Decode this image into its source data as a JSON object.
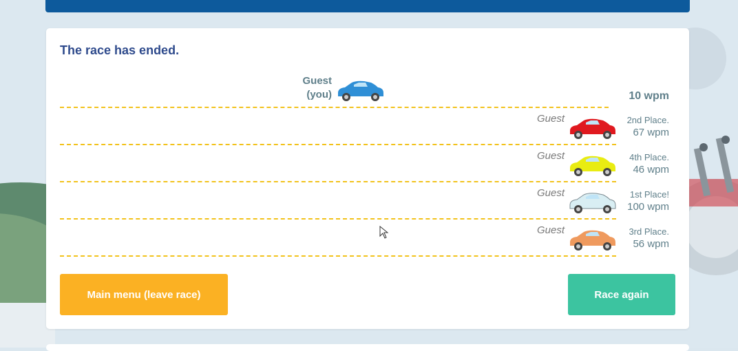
{
  "race": {
    "status_title": "The race has ended.",
    "you": {
      "name_line1": "Guest",
      "name_line2": "(you)",
      "wpm": "10 wpm",
      "car_color": "#2f8fd6"
    },
    "opponents": [
      {
        "name": "Guest",
        "place": "2nd Place.",
        "wpm": "67 wpm",
        "car_color": "#e0191f"
      },
      {
        "name": "Guest",
        "place": "4th Place.",
        "wpm": "46 wpm",
        "car_color": "#e9ec12"
      },
      {
        "name": "Guest",
        "place": "1st Place!",
        "wpm": "100 wpm",
        "car_color": "#d9eef3"
      },
      {
        "name": "Guest",
        "place": "3rd Place.",
        "wpm": "56 wpm",
        "car_color": "#ef9a5e"
      }
    ]
  },
  "buttons": {
    "main_menu": "Main menu (leave race)",
    "race_again": "Race again"
  },
  "colors": {
    "accent_blue": "#0d5a9c",
    "title_blue": "#2e4a8c",
    "lane_dash": "#f2c21a",
    "menu_button": "#fbb123",
    "again_button": "#3cc4a0"
  },
  "icons": [
    "car-icon",
    "mouse-cursor-icon"
  ]
}
